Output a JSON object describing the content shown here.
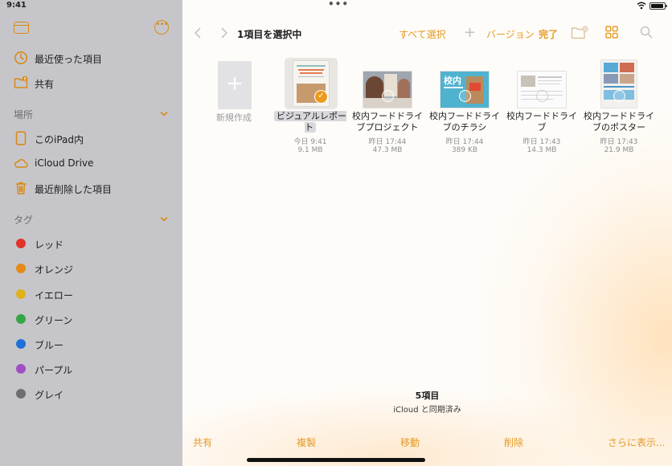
{
  "status": {
    "time": "9:41"
  },
  "sidebar": {
    "items_top": [
      {
        "label": "最近使った項目",
        "icon": "clock-icon"
      },
      {
        "label": "共有",
        "icon": "shared-folder-icon"
      }
    ],
    "sections": {
      "locations": "場所",
      "tags": "タグ"
    },
    "locations": [
      {
        "label": "このiPad内",
        "icon": "ipad-icon"
      },
      {
        "label": "iCloud Drive",
        "icon": "cloud-icon"
      },
      {
        "label": "最近削除した項目",
        "icon": "trash-icon"
      }
    ],
    "tags": [
      {
        "label": "レッド",
        "color": "#e0342a"
      },
      {
        "label": "オレンジ",
        "color": "#e58a17"
      },
      {
        "label": "イエロー",
        "color": "#e0b11a"
      },
      {
        "label": "グリーン",
        "color": "#35a645"
      },
      {
        "label": "ブルー",
        "color": "#1f70d8"
      },
      {
        "label": "パープル",
        "color": "#a14ec5"
      },
      {
        "label": "グレイ",
        "color": "#6e6e72"
      }
    ]
  },
  "navbar": {
    "title": "1項目を選択中",
    "select_all": "すべて選択",
    "version": "バージョン",
    "done": "完了"
  },
  "files": {
    "new_label": "新規作成",
    "items": [
      {
        "name": "ビジュアルレポート",
        "date": "今日 9:41",
        "size": "9.1 MB",
        "selected": true
      },
      {
        "name": "校内フードドライブプロジェクト",
        "date": "昨日 17:44",
        "size": "47.3 MB"
      },
      {
        "name": "校内フードドライブのチラシ",
        "date": "昨日 17:44",
        "size": "389 KB",
        "thumb_text": "校内"
      },
      {
        "name": "校内フードドライブ",
        "date": "昨日 17:43",
        "size": "14.3 MB"
      },
      {
        "name": "校内フードドライブのポスター",
        "date": "昨日 17:43",
        "size": "21.9 MB"
      }
    ]
  },
  "footer": {
    "count": "5項目",
    "sync_status": "iCloud と同期済み"
  },
  "toolbar": {
    "share": "共有",
    "duplicate": "複製",
    "move": "移動",
    "delete": "削除",
    "more": "さらに表示..."
  },
  "colors": {
    "accent": "#e39a26",
    "sidebar_bg": "#c6c6ca"
  }
}
